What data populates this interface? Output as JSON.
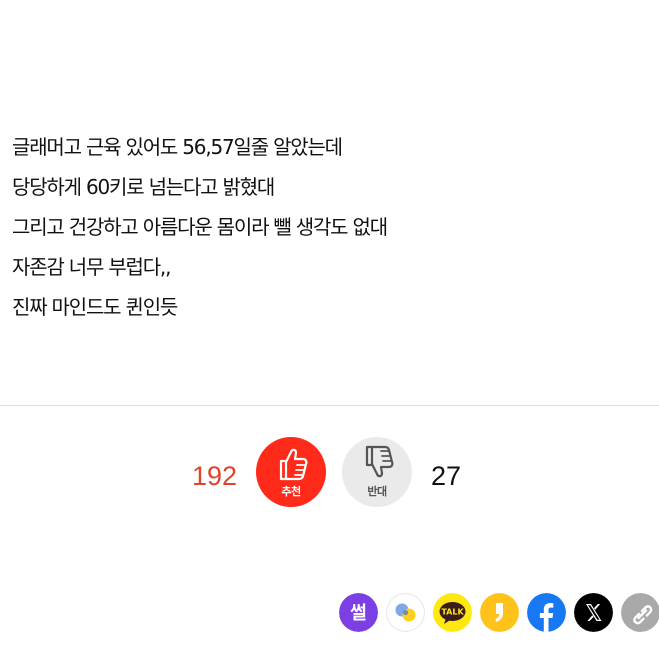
{
  "post": {
    "lines": [
      "글래머고 근육 있어도 56,57일줄 알았는데",
      "당당하게 60키로 넘는다고 밝혔대",
      "그리고 건강하고 아름다운 몸이라 뺄 생각도 없대",
      "자존감 너무 부럽다,,",
      "진짜 마인드도 퀸인듯"
    ]
  },
  "vote": {
    "up_count": "192",
    "up_label": "추천",
    "down_label": "반대",
    "down_count": "27",
    "up_color": "#ff2a1a",
    "up_count_color": "#e0442a",
    "down_bg": "#eaeaea"
  },
  "share": {
    "buttons": [
      {
        "name": "ssul",
        "label": "썰",
        "color": "#7b3fe4",
        "icon": "ssul-logo-icon"
      },
      {
        "name": "chat",
        "label": "",
        "color": "#ffffff",
        "icon": "chat-bubbles-icon"
      },
      {
        "name": "kakaotalk",
        "label": "TALK",
        "color": "#ffe812",
        "icon": "kakaotalk-icon"
      },
      {
        "name": "kakaostory",
        "label": "",
        "color": "#ffc21a",
        "icon": "kakaostory-icon"
      },
      {
        "name": "facebook",
        "label": "f",
        "color": "#1877f2",
        "icon": "facebook-icon"
      },
      {
        "name": "x",
        "label": "X",
        "color": "#000000",
        "icon": "x-icon"
      },
      {
        "name": "copy-link",
        "label": "",
        "color": "#a9a9a9",
        "icon": "link-icon"
      }
    ]
  }
}
